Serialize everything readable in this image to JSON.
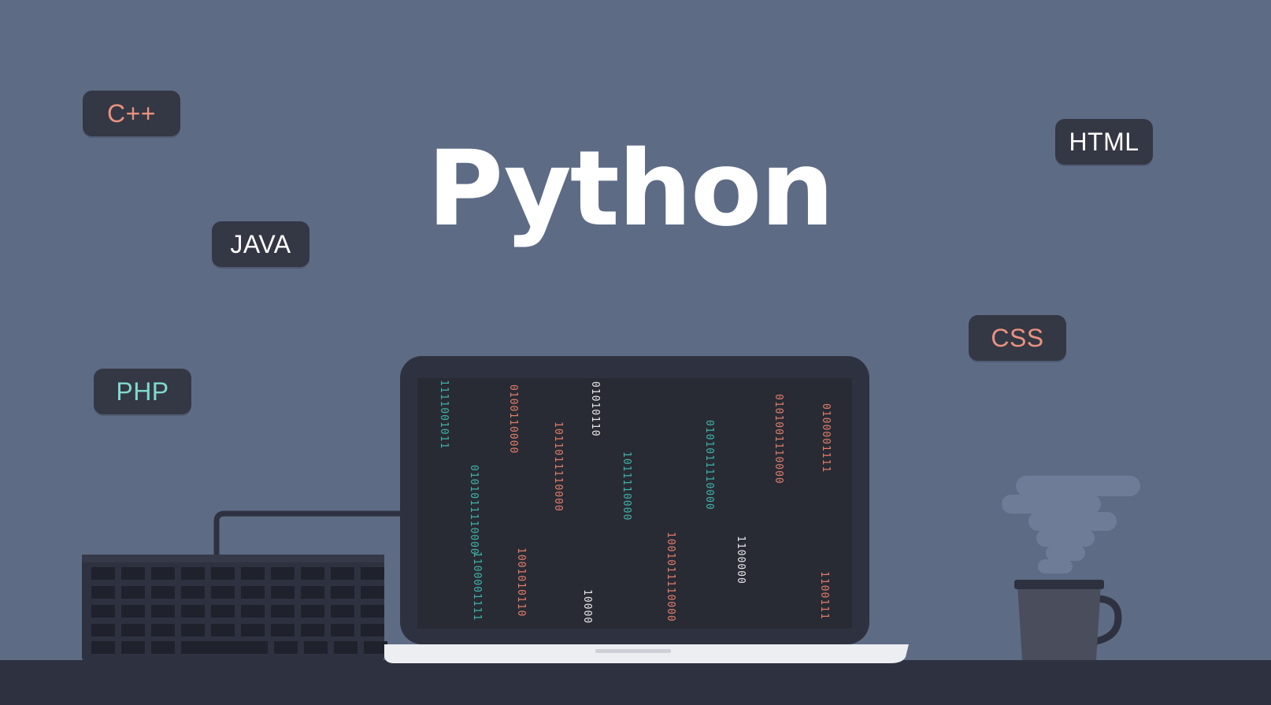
{
  "title": "Python",
  "tags": {
    "cpp": {
      "label": "C++",
      "color": "#e9927f"
    },
    "java": {
      "label": "JAVA",
      "color": "#ffffff"
    },
    "php": {
      "label": "PHP",
      "color": "#7fd9cf"
    },
    "html": {
      "label": "HTML",
      "color": "#ffffff"
    },
    "css": {
      "label": "CSS",
      "color": "#e9927f"
    }
  },
  "colors": {
    "background": "#5e6b85",
    "desk": "#2e3240",
    "tag_background": "#343744",
    "screen": "#2b2e38",
    "code_teal": "#3fb3a8",
    "code_salmon": "#e27d69",
    "code_white": "#e6e6e6"
  },
  "screen_code": [
    {
      "text": "1111001011",
      "color": "#3fb3a8"
    },
    {
      "text": "0100110000",
      "color": "#e27d69"
    },
    {
      "text": "01010110",
      "color": "#e6e6e6"
    },
    {
      "text": "0101011110000",
      "color": "#3fb3a8"
    },
    {
      "text": "1011011110000",
      "color": "#e27d69"
    },
    {
      "text": "1011110000",
      "color": "#3fb3a8"
    },
    {
      "text": "0101011110000",
      "color": "#3fb3a8"
    },
    {
      "text": "0101001110000",
      "color": "#e27d69"
    },
    {
      "text": "1001010110",
      "color": "#e27d69"
    },
    {
      "text": "1001011110000",
      "color": "#e27d69"
    },
    {
      "text": "10000",
      "color": "#e6e6e6"
    },
    {
      "text": "0100001111",
      "color": "#e27d69"
    },
    {
      "text": "1100000",
      "color": "#e6e6e6"
    },
    {
      "text": "1100001111",
      "color": "#3fb3a8"
    },
    {
      "text": "1100111",
      "color": "#e27d69"
    }
  ]
}
